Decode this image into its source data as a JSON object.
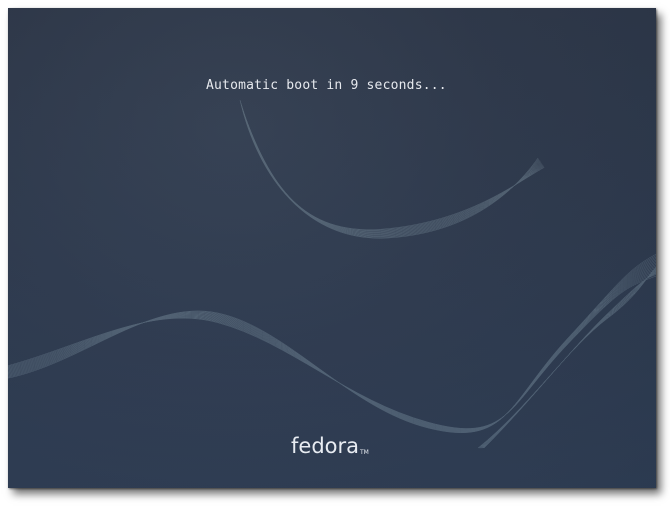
{
  "boot": {
    "message": "Automatic boot in 9 seconds..."
  },
  "logo": {
    "name": "fedora",
    "mark": "TM"
  },
  "colors": {
    "background": "#313b4d",
    "text": "#e6e9ee",
    "wave": "#9fb6bf"
  }
}
